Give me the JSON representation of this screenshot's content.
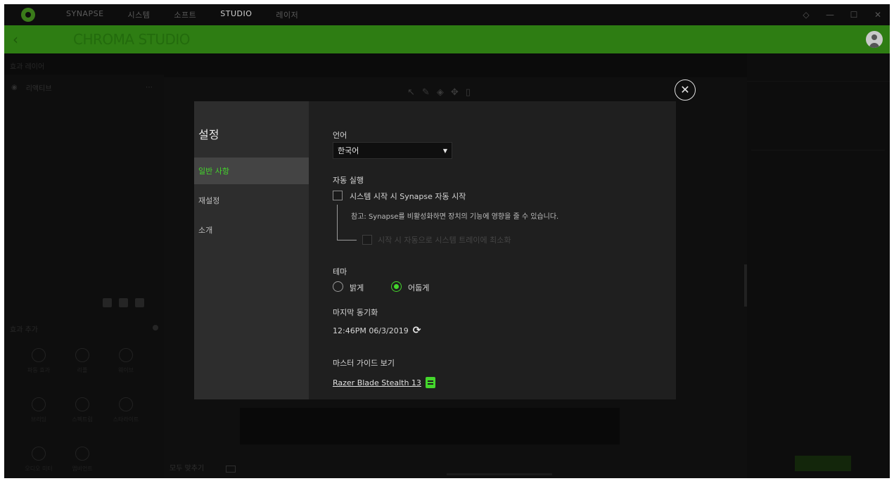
{
  "titlebar": {
    "nav": [
      "SYNAPSE",
      "시스템",
      "소프트",
      "STUDIO",
      "레이저"
    ],
    "active_index": 3
  },
  "header": {
    "title": "CHROMA STUDIO"
  },
  "left_panel": {
    "head": "효과 레이어",
    "layer_label": "리액티브",
    "effects_head": "효과 추가",
    "effects": [
      "파동 효과",
      "리플",
      "웨이브",
      "브리딩",
      "스펙트럼",
      "스타라이트",
      "오디오 미터",
      "앰비언트"
    ]
  },
  "canvas": {
    "bottom_label": "모두 맞추기"
  },
  "modal": {
    "title": "설정",
    "side_items": [
      "일반 사항",
      "재설정",
      "소개"
    ],
    "active_side": 0,
    "language_label": "언어",
    "language_value": "한국어",
    "autostart_label": "자동 실행",
    "autostart_checkbox": "시스템 시작 시 Synapse 자동 시작",
    "autostart_note": "참고: Synapse를 비활성화하면 장치의 기능에 영향을 줄 수 있습니다.",
    "minimize_checkbox": "시작 시 자동으로 시스템 트레이에 최소화",
    "theme_label": "테마",
    "theme_light": "밝게",
    "theme_dark": "어둡게",
    "theme_selected": "dark",
    "last_sync_label": "마지막 동기화",
    "last_sync_value": "12:46PM 06/3/2019",
    "guide_label": "마스터 가이드 보기",
    "guide_link": "Razer Blade Stealth 13"
  },
  "colors": {
    "accent": "#44d62c",
    "header_bg": "#2e7d13"
  },
  "icons": [
    "razer-logo-icon",
    "back-arrow-icon",
    "avatar-icon",
    "close-icon",
    "caret-down-icon",
    "sync-icon",
    "document-icon"
  ]
}
